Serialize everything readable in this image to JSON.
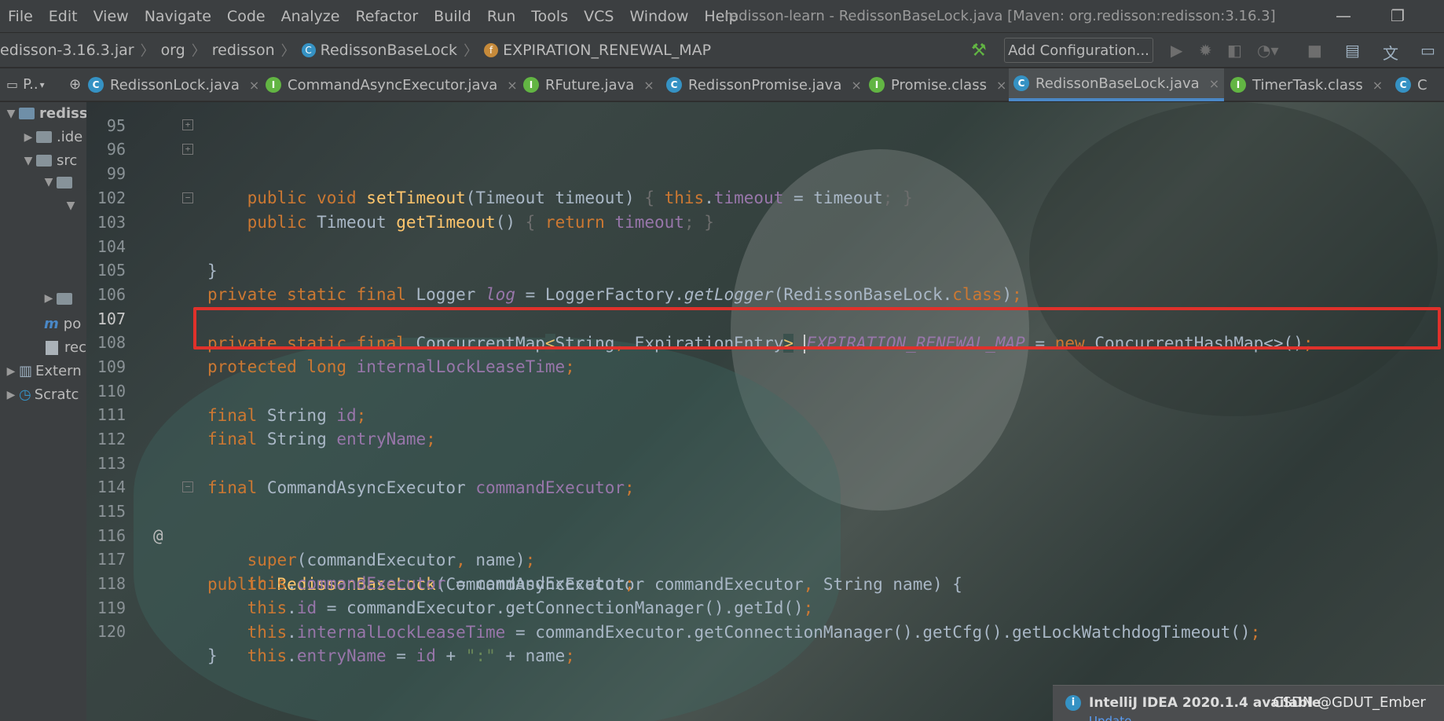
{
  "menu": [
    "File",
    "Edit",
    "View",
    "Navigate",
    "Code",
    "Analyze",
    "Refactor",
    "Build",
    "Run",
    "Tools",
    "VCS",
    "Window",
    "Help"
  ],
  "window_title": "redisson-learn - RedissonBaseLock.java [Maven: org.redisson:redisson:3.16.3]",
  "breadcrumb": {
    "jar": "edisson-3.16.3.jar",
    "pkg1": "org",
    "pkg2": "redisson",
    "cls": "RedissonBaseLock",
    "field": "EXPIRATION_RENEWAL_MAP"
  },
  "toolbar": {
    "add_config": "Add Configuration..."
  },
  "project_dropdown": "P..",
  "tabs": [
    {
      "label": "RedissonLock.java",
      "icon": "class-icon"
    },
    {
      "label": "CommandAsyncExecutor.java",
      "icon": "interface-icon"
    },
    {
      "label": "RFuture.java",
      "icon": "interface-icon"
    },
    {
      "label": "RedissonPromise.java",
      "icon": "class-icon"
    },
    {
      "label": "Promise.class",
      "icon": "interface-icon"
    },
    {
      "label": "RedissonBaseLock.java",
      "icon": "class-icon",
      "active": true
    },
    {
      "label": "TimerTask.class",
      "icon": "interface-icon"
    },
    {
      "label": "C",
      "icon": "class-icon"
    }
  ],
  "sidebar": {
    "root": "rediss",
    "idea": ".ide",
    "src": "src",
    "pom": "po",
    "rec": "rec",
    "external": "Extern",
    "scratch": "Scratc"
  },
  "code_lines": {
    "l95": "95",
    "l96": "96",
    "l99": "99",
    "l102": "102",
    "l103": "103",
    "l104": "104",
    "l105": "105",
    "l106": "106",
    "l107": "107",
    "l108": "108",
    "l109": "109",
    "l110": "110",
    "l111": "111",
    "l112": "112",
    "l113": "113",
    "l114": "114",
    "l115": "115",
    "l116": "116",
    "l117": "117",
    "l118": "118",
    "l119": "119",
    "l120": "120"
  },
  "notification": {
    "text": "IntelliJ IDEA 2020.1.4 available",
    "link": "Update..."
  },
  "watermark": "CSDN @GDUT_Ember"
}
